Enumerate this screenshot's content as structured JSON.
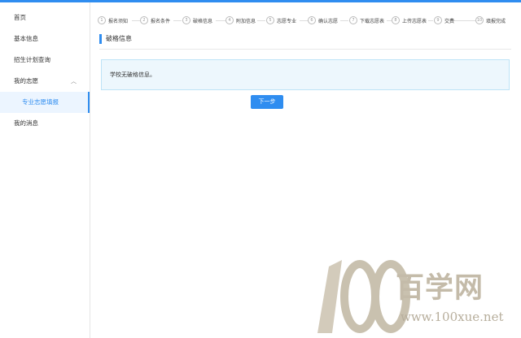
{
  "sidebar": {
    "items": [
      {
        "label": "首页"
      },
      {
        "label": "基本信息"
      },
      {
        "label": "招生计划查询"
      },
      {
        "label": "我的志愿"
      },
      {
        "label": "专业志愿填报"
      },
      {
        "label": "我的消息"
      }
    ]
  },
  "steps": [
    {
      "num": "1",
      "label": "报名须知"
    },
    {
      "num": "2",
      "label": "报名条件"
    },
    {
      "num": "3",
      "label": "破格信息"
    },
    {
      "num": "4",
      "label": "附加信息"
    },
    {
      "num": "5",
      "label": "志愿专业"
    },
    {
      "num": "6",
      "label": "确认志愿"
    },
    {
      "num": "7",
      "label": "下载志愿表"
    },
    {
      "num": "8",
      "label": "上传志愿表"
    },
    {
      "num": "9",
      "label": "交费"
    },
    {
      "num": "10",
      "label": "填报完成"
    }
  ],
  "main": {
    "section_title": "破格信息",
    "info_text": "学校无破格信息。",
    "next_label": "下一步"
  },
  "watermark": {
    "logo_text": "100",
    "chinese": "百学网",
    "url": "www.100xue.net"
  },
  "colors": {
    "accent": "#2f8df0",
    "info_bg": "#edf7fd",
    "watermark": "#c4bba9"
  }
}
